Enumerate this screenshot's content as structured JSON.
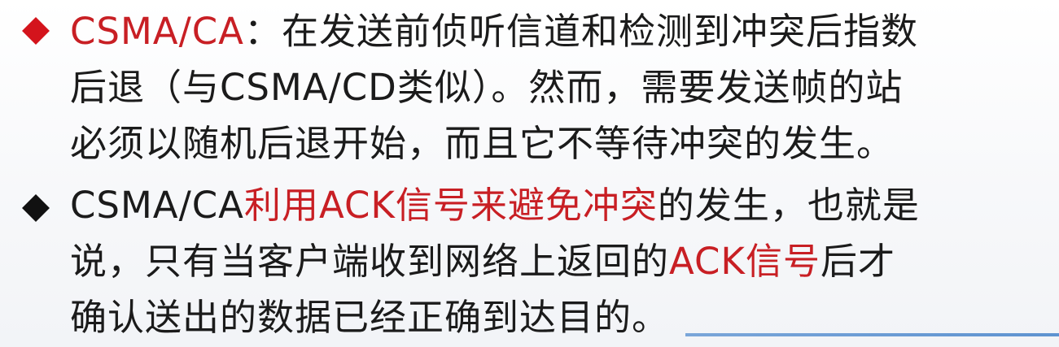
{
  "bullets": [
    {
      "lines": [
        [
          {
            "text": "CSMA/CA",
            "color": "red"
          },
          {
            "text": "：在发送前侦听信道和检测到冲突后指数",
            "color": "dark"
          }
        ],
        [
          {
            "text": "后退（与CSMA/CD类似）。然而，需要发送帧的站",
            "color": "dark"
          }
        ],
        [
          {
            "text": "必须以随机后退开始，而且它不等待冲突的发生。",
            "color": "dark"
          }
        ]
      ]
    },
    {
      "lines": [
        [
          {
            "text": "CSMA/CA",
            "color": "dark"
          },
          {
            "text": "利用ACK信号来避免冲突",
            "color": "red"
          },
          {
            "text": "的发生，也就是",
            "color": "dark"
          }
        ],
        [
          {
            "text": "说，只有当客户端收到网络上返回的",
            "color": "dark"
          },
          {
            "text": "ACK信号",
            "color": "red"
          },
          {
            "text": "后才",
            "color": "dark"
          }
        ],
        [
          {
            "text": "确认送出的数据已经正确到达目的。",
            "color": "dark"
          }
        ]
      ]
    }
  ],
  "colors": {
    "red": "#c81f24",
    "dark": "#1b1b1b",
    "bullet_red": "#d4141c",
    "bullet_black": "#111111"
  }
}
